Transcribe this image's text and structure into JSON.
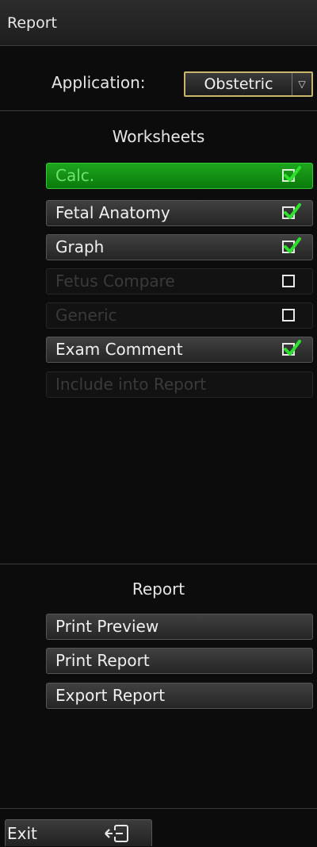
{
  "title": "Report",
  "application": {
    "label": "Application:",
    "value": "Obstetric"
  },
  "worksheets": {
    "title": "Worksheets",
    "items": [
      {
        "label": "Calc.",
        "state": "active",
        "checked": true
      },
      {
        "label": "Fetal Anatomy",
        "state": "normal",
        "checked": true
      },
      {
        "label": "Graph",
        "state": "normal",
        "checked": true
      },
      {
        "label": "Fetus Compare",
        "state": "disabled",
        "checked": false
      },
      {
        "label": "Generic",
        "state": "disabled",
        "checked": false
      },
      {
        "label": "Exam Comment",
        "state": "normal",
        "checked": true
      },
      {
        "label": "Include into Report",
        "state": "disabled",
        "checked": null
      }
    ]
  },
  "report": {
    "title": "Report",
    "buttons": [
      "Print Preview",
      "Print Report",
      "Export Report"
    ]
  },
  "exit": {
    "label": "Exit",
    "icon": "exit-icon"
  },
  "colors": {
    "active_green": "#1ea51e",
    "check_green": "#2ee02e",
    "highlight_gold": "#c9b66a"
  }
}
